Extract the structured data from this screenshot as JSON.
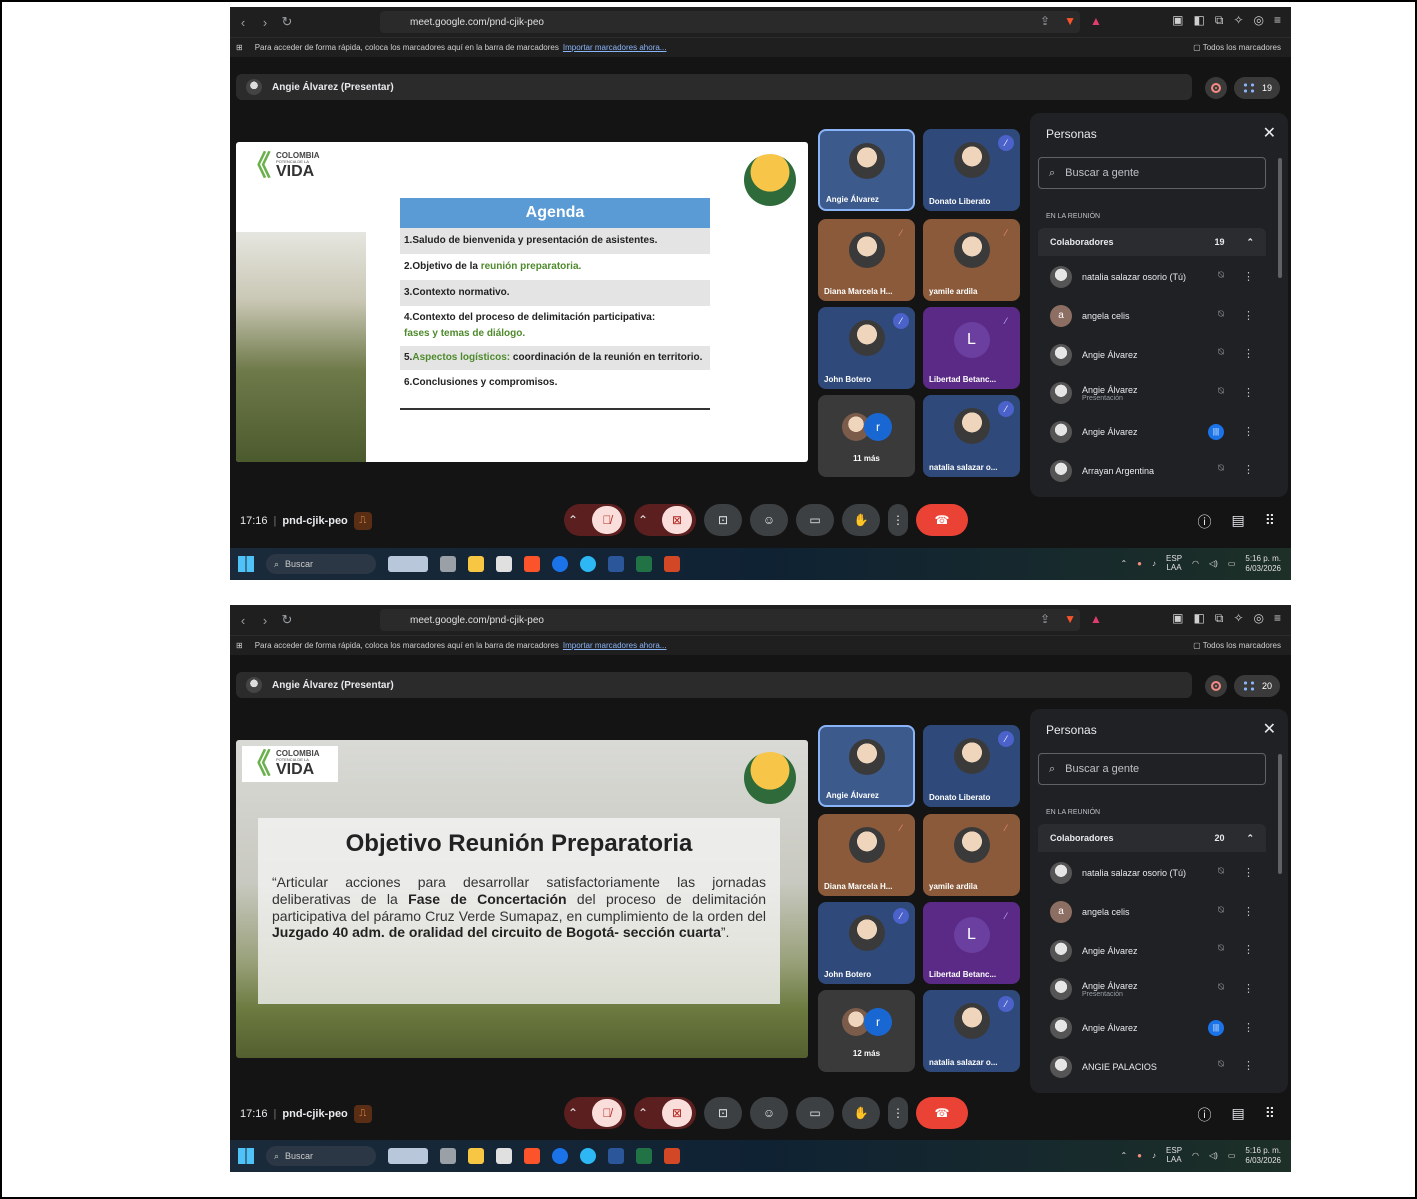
{
  "shots": [
    {
      "browser": {
        "url": "meet.google.com/pnd-cjik-peo",
        "bookmarks_text": "Para acceder de forma rápida, coloca los marcadores aquí en la barra de marcadores",
        "bookmarks_link": "Importar marcadores ahora...",
        "all_bookmarks": "Todos los marcadores"
      },
      "presenting": "Angie Álvarez (Presentar)",
      "participant_count": "19",
      "slide": {
        "logo_l1": "COLOMBIA",
        "logo_l2": "POTENCIA DE LA",
        "logo_l3": "VIDA",
        "agenda_title": "Agenda",
        "items": [
          "1.Saludo de bienvenida y presentación de asistentes.",
          "2.Objetivo de la ",
          "3.Contexto normativo.",
          "4.Contexto del proceso de delimitación participativa: ",
          "5.",
          "6.Conclusiones y compromisos."
        ],
        "item2_green": "reunión preparatoria.",
        "item4_green": "fases y temas de diálogo.",
        "item5_green": "Aspectos logísticos:",
        "item5_rest": " coordinación de la reunión en territorio."
      },
      "tiles": [
        {
          "name": "Angie Álvarez"
        },
        {
          "name": "Donato Liberato"
        },
        {
          "name": "Diana Marcela H..."
        },
        {
          "name": "yamile ardila"
        },
        {
          "name": "John Botero"
        },
        {
          "name": "Libertad Betanc...",
          "letter": "L"
        },
        {
          "more": "11 más",
          "letter": "r"
        },
        {
          "name": "natalia salazar o..."
        }
      ],
      "panel": {
        "title": "Personas",
        "search_placeholder": "Buscar a gente",
        "in_meeting": "EN LA REUNIÓN",
        "collab": "Colaboradores",
        "collab_count": "19",
        "people": [
          {
            "name": "natalia salazar osorio (Tú)"
          },
          {
            "name": "angela celis",
            "initial": "a"
          },
          {
            "name": "Angie Álvarez"
          },
          {
            "name": "Angie Álvarez",
            "sub": "Presentación"
          },
          {
            "name": "Angie Álvarez"
          },
          {
            "name": "Arrayan Argentina"
          }
        ]
      },
      "bottom": {
        "time": "17:16",
        "code": "pnd-cjik-peo"
      },
      "taskbar": {
        "search": "Buscar",
        "lang1": "ESP",
        "lang2": "LAA",
        "time": "5:16 p. m.",
        "date": "6/03/2026"
      }
    },
    {
      "browser": {
        "url": "meet.google.com/pnd-cjik-peo",
        "bookmarks_text": "Para acceder de forma rápida, coloca los marcadores aquí en la barra de marcadores",
        "bookmarks_link": "Importar marcadores ahora...",
        "all_bookmarks": "Todos los marcadores"
      },
      "presenting": "Angie Álvarez (Presentar)",
      "participant_count": "20",
      "slide": {
        "logo_l1": "COLOMBIA",
        "logo_l2": "POTENCIA DE LA",
        "logo_l3": "VIDA",
        "title": "Objetivo Reunión Preparatoria",
        "t1": "“Articular acciones para desarrollar satisfactoriamente las jornadas deliberativas de la ",
        "b1": "Fase de Concertación",
        "t2": " del proceso de delimitación participativa del páramo Cruz Verde Sumapaz, en cumplimiento de la orden del ",
        "b2": "Juzgado 40 adm. de oralidad del circuito de Bogotá- sección cuarta",
        "t3": "”."
      },
      "tiles": [
        {
          "name": "Angie Álvarez"
        },
        {
          "name": "Donato Liberato"
        },
        {
          "name": "Diana Marcela H..."
        },
        {
          "name": "yamile ardila"
        },
        {
          "name": "John Botero"
        },
        {
          "name": "Libertad Betanc...",
          "letter": "L"
        },
        {
          "more": "12 más",
          "letter": "r"
        },
        {
          "name": "natalia salazar o..."
        }
      ],
      "panel": {
        "title": "Personas",
        "search_placeholder": "Buscar a gente",
        "in_meeting": "EN LA REUNIÓN",
        "collab": "Colaboradores",
        "collab_count": "20",
        "people": [
          {
            "name": "natalia salazar osorio (Tú)"
          },
          {
            "name": "angela celis",
            "initial": "a"
          },
          {
            "name": "Angie Álvarez"
          },
          {
            "name": "Angie Álvarez",
            "sub": "Presentación"
          },
          {
            "name": "Angie Álvarez"
          },
          {
            "name": "ANGIE PALACIOS"
          }
        ]
      },
      "bottom": {
        "time": "17:16",
        "code": "pnd-cjik-peo"
      },
      "taskbar": {
        "search": "Buscar",
        "lang1": "ESP",
        "lang2": "LAA",
        "time": "5:16 p. m.",
        "date": "6/03/2026"
      }
    }
  ],
  "colors": {
    "accent": "#8ab4f8",
    "end_call": "#ea4335",
    "agenda_header": "#5b9bd5",
    "green_text": "#4e8a2c"
  }
}
